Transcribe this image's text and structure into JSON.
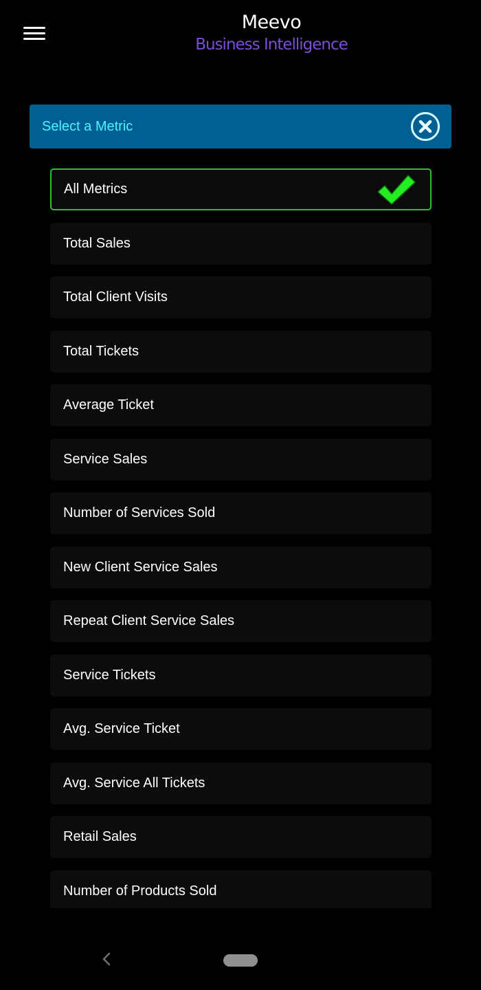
{
  "header": {
    "brand": "Meevo",
    "subtitle": "Business Intelligence",
    "menu_icon": "hamburger-menu-icon"
  },
  "panel": {
    "title": "Select a Metric",
    "close_icon": "close-circle-icon",
    "accent_color": "#4ff3ff",
    "header_color": "#015f93"
  },
  "metrics": [
    {
      "label": "All Metrics",
      "selected": true
    },
    {
      "label": "Total Sales"
    },
    {
      "label": "Total Client Visits"
    },
    {
      "label": "Total Tickets"
    },
    {
      "label": "Average Ticket"
    },
    {
      "label": "Service Sales"
    },
    {
      "label": "Number of Services Sold"
    },
    {
      "label": "New Client Service Sales"
    },
    {
      "label": "Repeat Client Service Sales"
    },
    {
      "label": "Service Tickets"
    },
    {
      "label": "Avg. Service Ticket"
    },
    {
      "label": "Avg. Service All Tickets"
    },
    {
      "label": "Retail Sales"
    },
    {
      "label": "Number of Products Sold"
    }
  ],
  "selected_check_icon": "checkmark-icon",
  "selected_color": "#2fbf2f",
  "navigation": {
    "back_icon": "back-chevron-icon",
    "home_icon": "home-pill-icon"
  }
}
